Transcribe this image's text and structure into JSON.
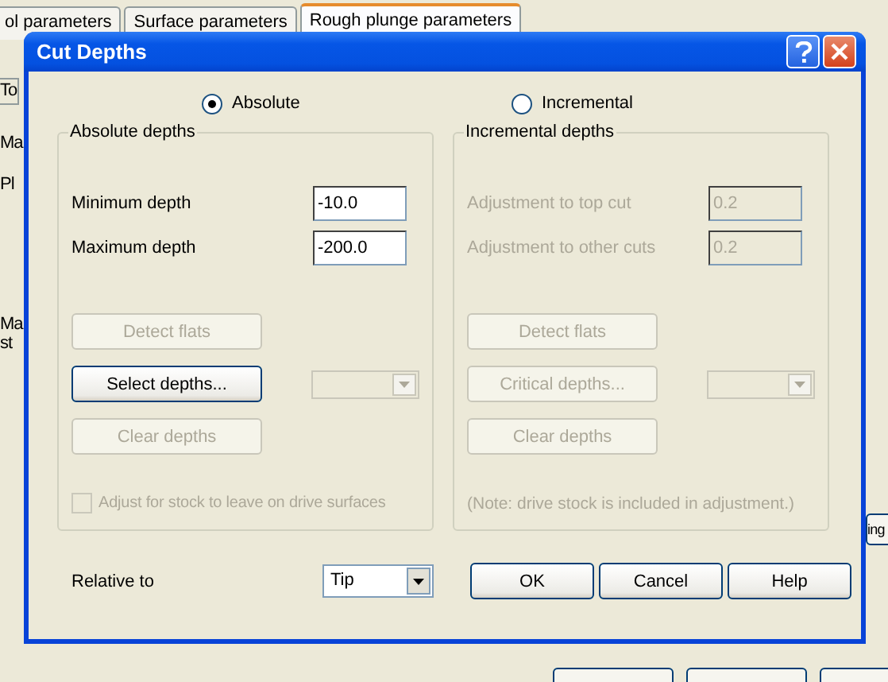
{
  "background": {
    "tabs": [
      {
        "label": "ol parameters",
        "selected": false
      },
      {
        "label": "Surface parameters",
        "selected": false
      },
      {
        "label": "Rough plunge parameters",
        "selected": true
      }
    ],
    "side_labels": [
      "To",
      "Ma",
      "Pl",
      "Ma",
      "st"
    ],
    "right_button": "ing"
  },
  "dialog": {
    "title": "Cut Depths",
    "modes": [
      {
        "label": "Absolute",
        "selected": true
      },
      {
        "label": "Incremental",
        "selected": false
      }
    ],
    "groups": [
      {
        "title": "Absolute depths",
        "fields": [
          {
            "label": "Minimum depth",
            "value": "-10.0",
            "disabled": false
          },
          {
            "label": "Maximum depth",
            "value": "-200.0",
            "disabled": false
          }
        ],
        "buttons": [
          {
            "label": "Detect flats",
            "disabled": true
          },
          {
            "label": "Select depths...",
            "disabled": false
          },
          {
            "label": "Clear depths",
            "disabled": true
          }
        ],
        "dropdown": {
          "disabled": true
        },
        "footer": {
          "kind": "checkbox",
          "label": "Adjust for stock to leave on drive surfaces",
          "checked": false,
          "disabled": true
        }
      },
      {
        "title": "Incremental depths",
        "fields": [
          {
            "label": "Adjustment to top cut",
            "value": "0.2",
            "disabled": true
          },
          {
            "label": "Adjustment to other cuts",
            "value": "0.2",
            "disabled": true
          }
        ],
        "buttons": [
          {
            "label": "Detect flats",
            "disabled": true
          },
          {
            "label": "Critical depths...",
            "disabled": true
          },
          {
            "label": "Clear depths",
            "disabled": true
          }
        ],
        "dropdown": {
          "disabled": true
        },
        "footer": {
          "kind": "note",
          "label": "(Note:  drive stock is included in adjustment.)",
          "disabled": true
        }
      }
    ],
    "relative_to": {
      "label": "Relative to",
      "value": "Tip"
    },
    "buttons": [
      "OK",
      "Cancel",
      "Help"
    ]
  }
}
